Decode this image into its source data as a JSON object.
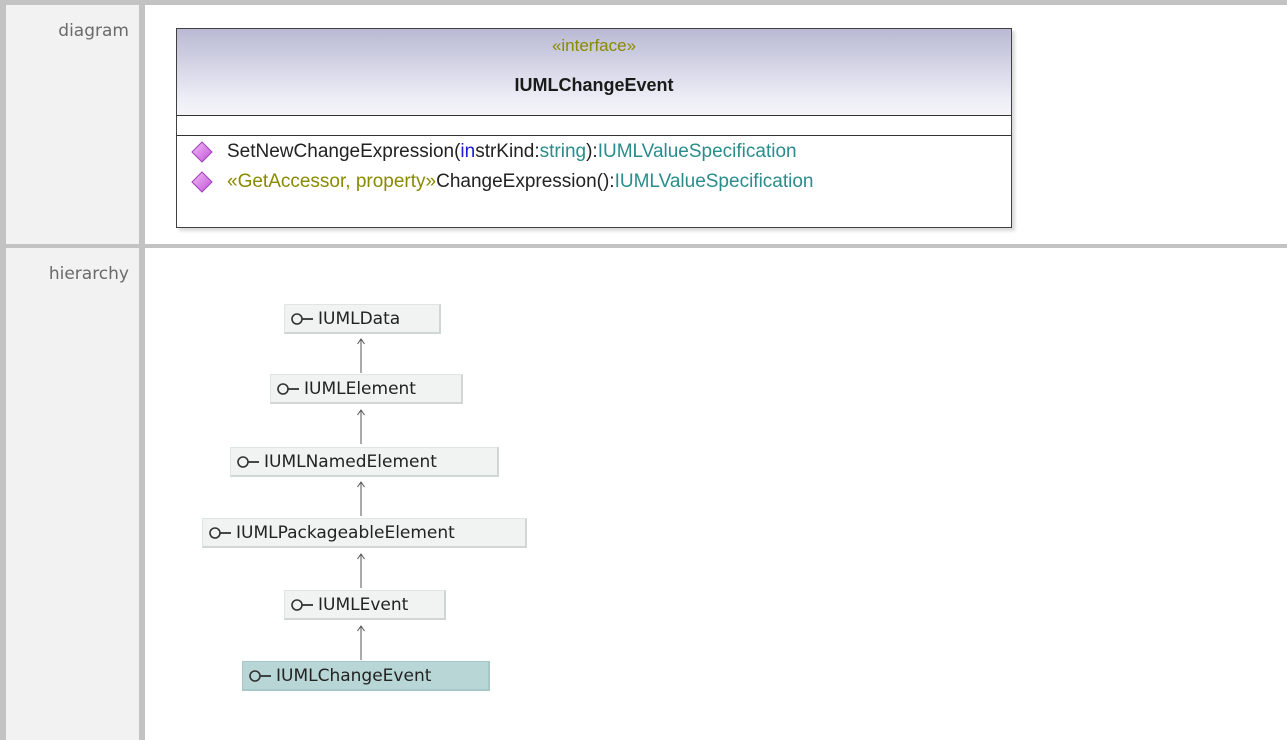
{
  "row_labels": {
    "diagram": "diagram",
    "hierarchy": "hierarchy"
  },
  "uml_class": {
    "stereotype": "«interface»",
    "name": "IUMLChangeEvent",
    "operations": [
      {
        "name": "SetNewChangeExpression(",
        "direction": "in",
        "param": " strKind:",
        "param_type": "string",
        "return_sep": "):",
        "return_type": "IUMLValueSpecification"
      },
      {
        "stereotype": "«GetAccessor, property»",
        "name": " ChangeExpression():",
        "return_type": "IUMLValueSpecification"
      }
    ]
  },
  "hierarchy": [
    {
      "name": "IUMLData",
      "current": false
    },
    {
      "name": "IUMLElement",
      "current": false
    },
    {
      "name": "IUMLNamedElement",
      "current": false
    },
    {
      "name": "IUMLPackageableElement",
      "current": false
    },
    {
      "name": "IUMLEvent",
      "current": false
    },
    {
      "name": "IUMLChangeEvent",
      "current": true
    }
  ],
  "colors": {
    "stereotype": "#8a8a00",
    "type": "#2a8c8c",
    "direction": "#1a1ad8",
    "operation_icon": "#d070e0",
    "current_node": "#b9d6d6",
    "node": "#f0f3f2"
  }
}
